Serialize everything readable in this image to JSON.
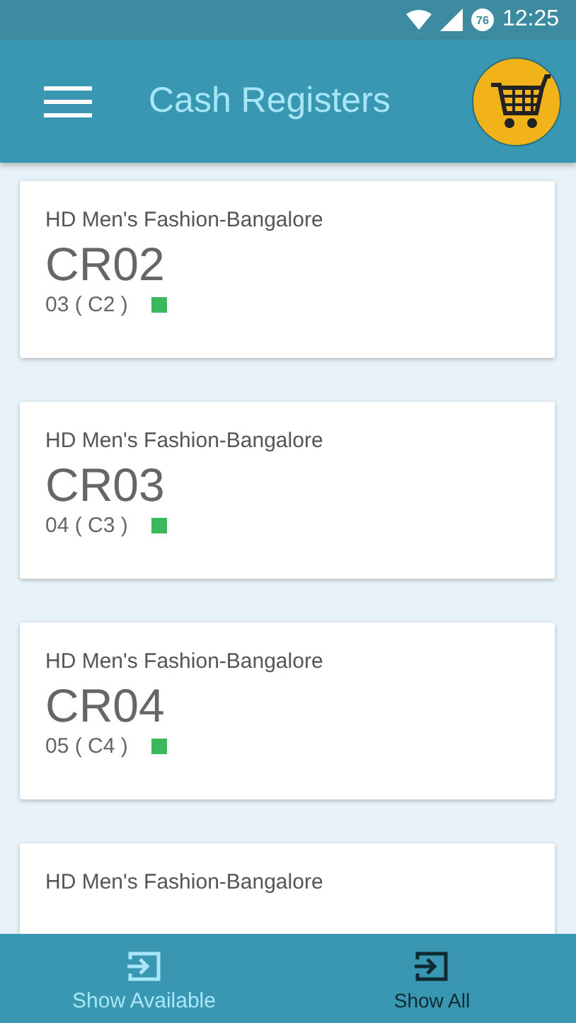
{
  "status_bar": {
    "time": "12:25",
    "battery": "76"
  },
  "app_bar": {
    "title": "Cash Registers"
  },
  "registers": [
    {
      "store": "HD Men's Fashion-Bangalore",
      "name": "CR02",
      "terminal": "03 ( C2 )",
      "color": "#3cb85c"
    },
    {
      "store": "HD Men's Fashion-Bangalore",
      "name": "CR03",
      "terminal": "04 ( C3 )",
      "color": "#3cb85c"
    },
    {
      "store": "HD Men's Fashion-Bangalore",
      "name": "CR04",
      "terminal": "05 ( C4 )",
      "color": "#3cb85c"
    },
    {
      "store": "HD Men's Fashion-Bangalore"
    }
  ],
  "bottom_nav": [
    {
      "label": "Show Available",
      "selected": false
    },
    {
      "label": "Show All",
      "selected": true
    }
  ]
}
